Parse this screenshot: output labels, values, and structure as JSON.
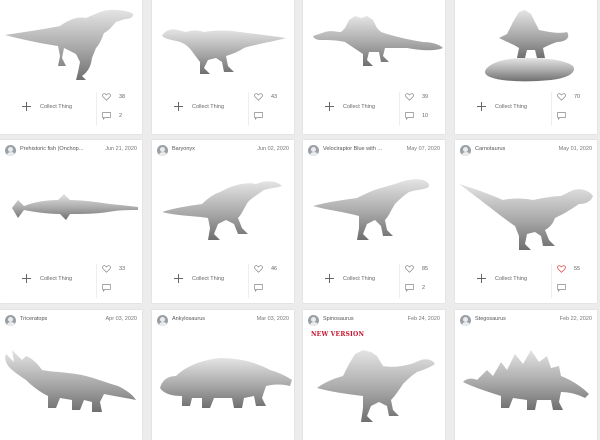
{
  "collect_label": "Collect Thing",
  "colors": {
    "heart_active": "#e05a5a",
    "icon": "#888888",
    "model": "#9a9a9a"
  },
  "cards": [
    {
      "title": "",
      "date": "",
      "likes": "38",
      "comments": "2",
      "model_icon": "allosaurus-model"
    },
    {
      "title": "",
      "date": "",
      "likes": "43",
      "comments": "",
      "model_icon": "iguanodon-model"
    },
    {
      "title": "",
      "date": "",
      "likes": "39",
      "comments": "10",
      "model_icon": "spinosaurus-model"
    },
    {
      "title": "",
      "date": "",
      "likes": "70",
      "comments": "",
      "model_icon": "spinosaurus-diorama-model"
    },
    {
      "title": "Prehistoric fish (Onchop...",
      "date": "Jun 21, 2020",
      "likes": "33",
      "comments": "",
      "model_icon": "sawfish-model"
    },
    {
      "title": "Baryonyx",
      "date": "Jun 02, 2020",
      "likes": "46",
      "comments": "",
      "model_icon": "baryonyx-model"
    },
    {
      "title": "Velociraptor Blue with ...",
      "date": "May 07, 2020",
      "likes": "85",
      "comments": "2",
      "model_icon": "velociraptor-model"
    },
    {
      "title": "Carnotaurus",
      "date": "May 01, 2020",
      "likes": "55",
      "comments": "",
      "liked": true,
      "model_icon": "carnotaurus-model"
    },
    {
      "title": "Triceratops",
      "date": "Apr 03, 2020",
      "model_icon": "triceratops-model"
    },
    {
      "title": "Ankylosaurus",
      "date": "Mar 03, 2020",
      "model_icon": "ankylosaurus-model"
    },
    {
      "title": "Spinosaurus",
      "date": "Feb 24, 2020",
      "badge": "NEW VERSION",
      "model_icon": "spinosaurus-model"
    },
    {
      "title": "Stegosaurus",
      "date": "Feb 22, 2020",
      "model_icon": "stegosaurus-model"
    }
  ]
}
